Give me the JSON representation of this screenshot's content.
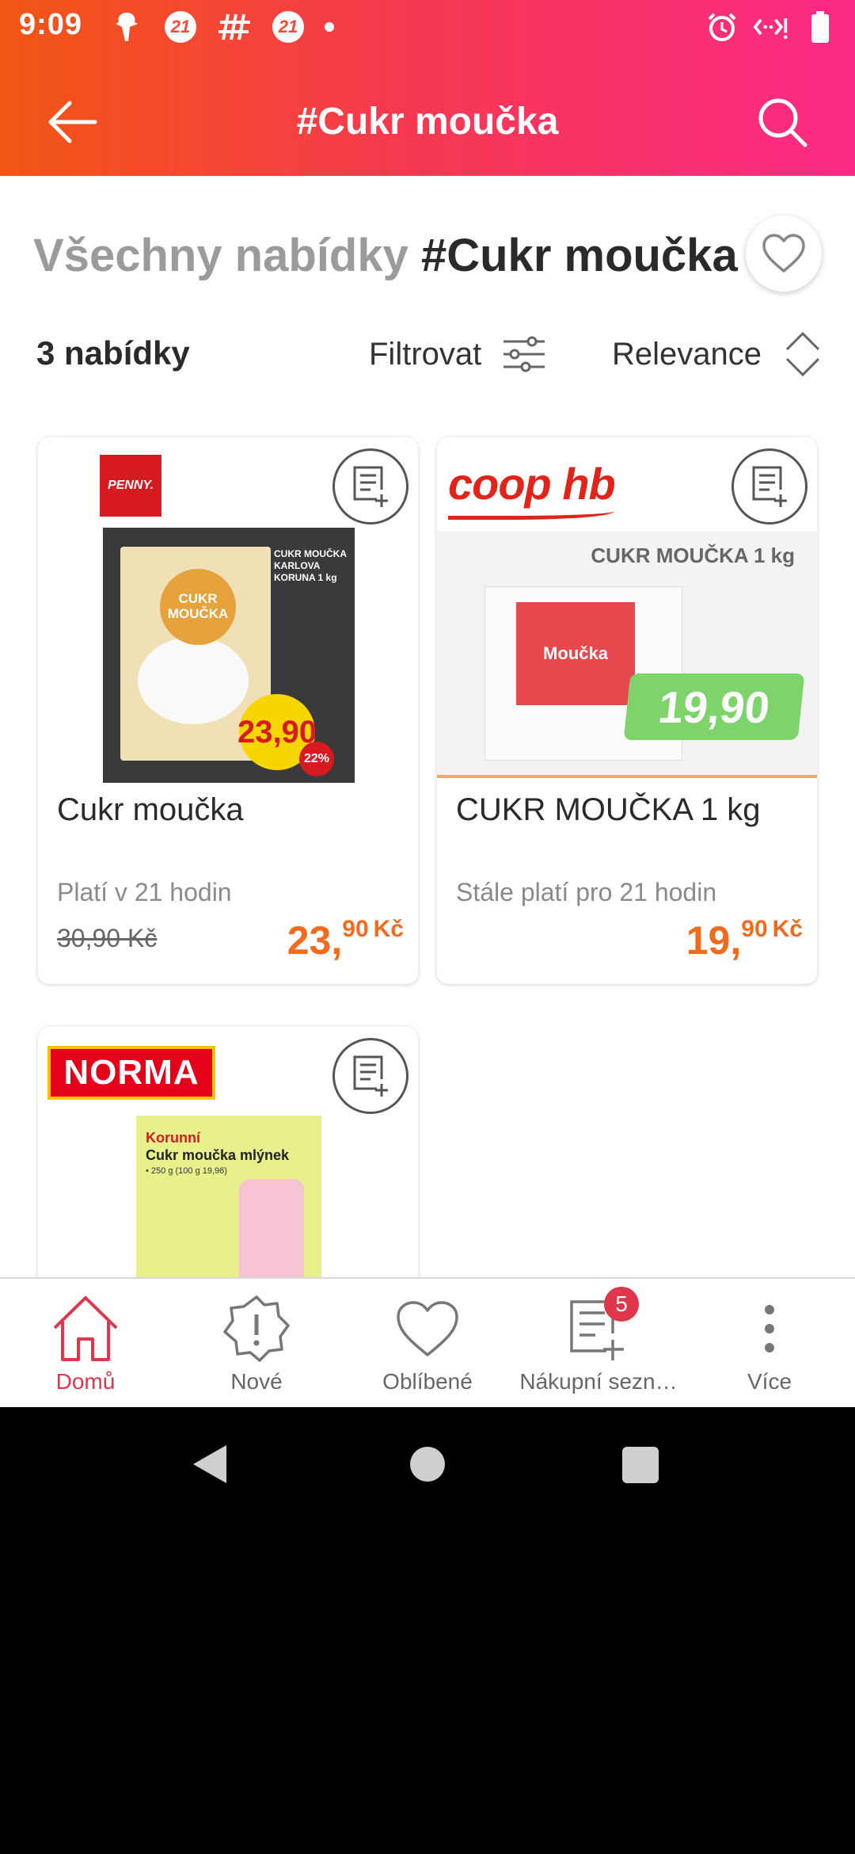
{
  "status_bar": {
    "time": "9:09",
    "badge_1": "21",
    "badge_2": "21",
    "icons": [
      "notification-icon",
      "badge-21",
      "hash-icon",
      "badge-21",
      "dot",
      "alarm-icon",
      "data-icon",
      "battery-icon"
    ]
  },
  "app_bar": {
    "title": "#Cukr moučka",
    "back_icon": "arrow-left-icon",
    "search_icon": "search-icon"
  },
  "heading": {
    "muted": "Všechny nabídky",
    "strong": "#Cukr moučka"
  },
  "toolbar": {
    "count": "3 nabídky",
    "filter_label": "Filtrovat",
    "sort_label": "Relevance"
  },
  "offers": [
    {
      "store": "PENNY.",
      "title": "Cukr moučka",
      "validity": "Platí v 21 hodin",
      "old_price": "30,90 Kč",
      "price_main": "23,",
      "price_cents": "90",
      "currency": "Kč",
      "image_text": {
        "pack": "CUKR MOUČKA",
        "side": "CUKR MOUČKA KARLOVA KORUNA 1 kg",
        "price": "23,90",
        "discount": "22%"
      }
    },
    {
      "store": "coop hb",
      "title": "CUKR MOUČKA 1 kg",
      "validity": "Stále platí pro 21 hodin",
      "old_price": "",
      "price_main": "19,",
      "price_cents": "90",
      "currency": "Kč",
      "image_text": {
        "header": "CUKR MOUČKA 1 kg",
        "label": "Moučka",
        "price": "19,90"
      }
    },
    {
      "store": "NORMA",
      "title": "",
      "image_text": {
        "brand": "Korunní",
        "name": "Cukr moučka mlýnek",
        "detail": "• 250 g (100 g 19,96)"
      }
    }
  ],
  "bottom_nav": [
    {
      "label": "Domů",
      "icon": "home-icon",
      "active": true
    },
    {
      "label": "Nové",
      "icon": "new-icon",
      "active": false
    },
    {
      "label": "Oblíbené",
      "icon": "heart-icon",
      "active": false
    },
    {
      "label": "Nákupní sezn…",
      "icon": "shopping-list-icon",
      "active": false,
      "badge": "5"
    },
    {
      "label": "Více",
      "icon": "more-icon",
      "active": false
    }
  ],
  "colors": {
    "header_start": "#f25613",
    "header_end": "#fb2a86",
    "price": "#f26b1d",
    "active_nav": "#e0364b"
  }
}
